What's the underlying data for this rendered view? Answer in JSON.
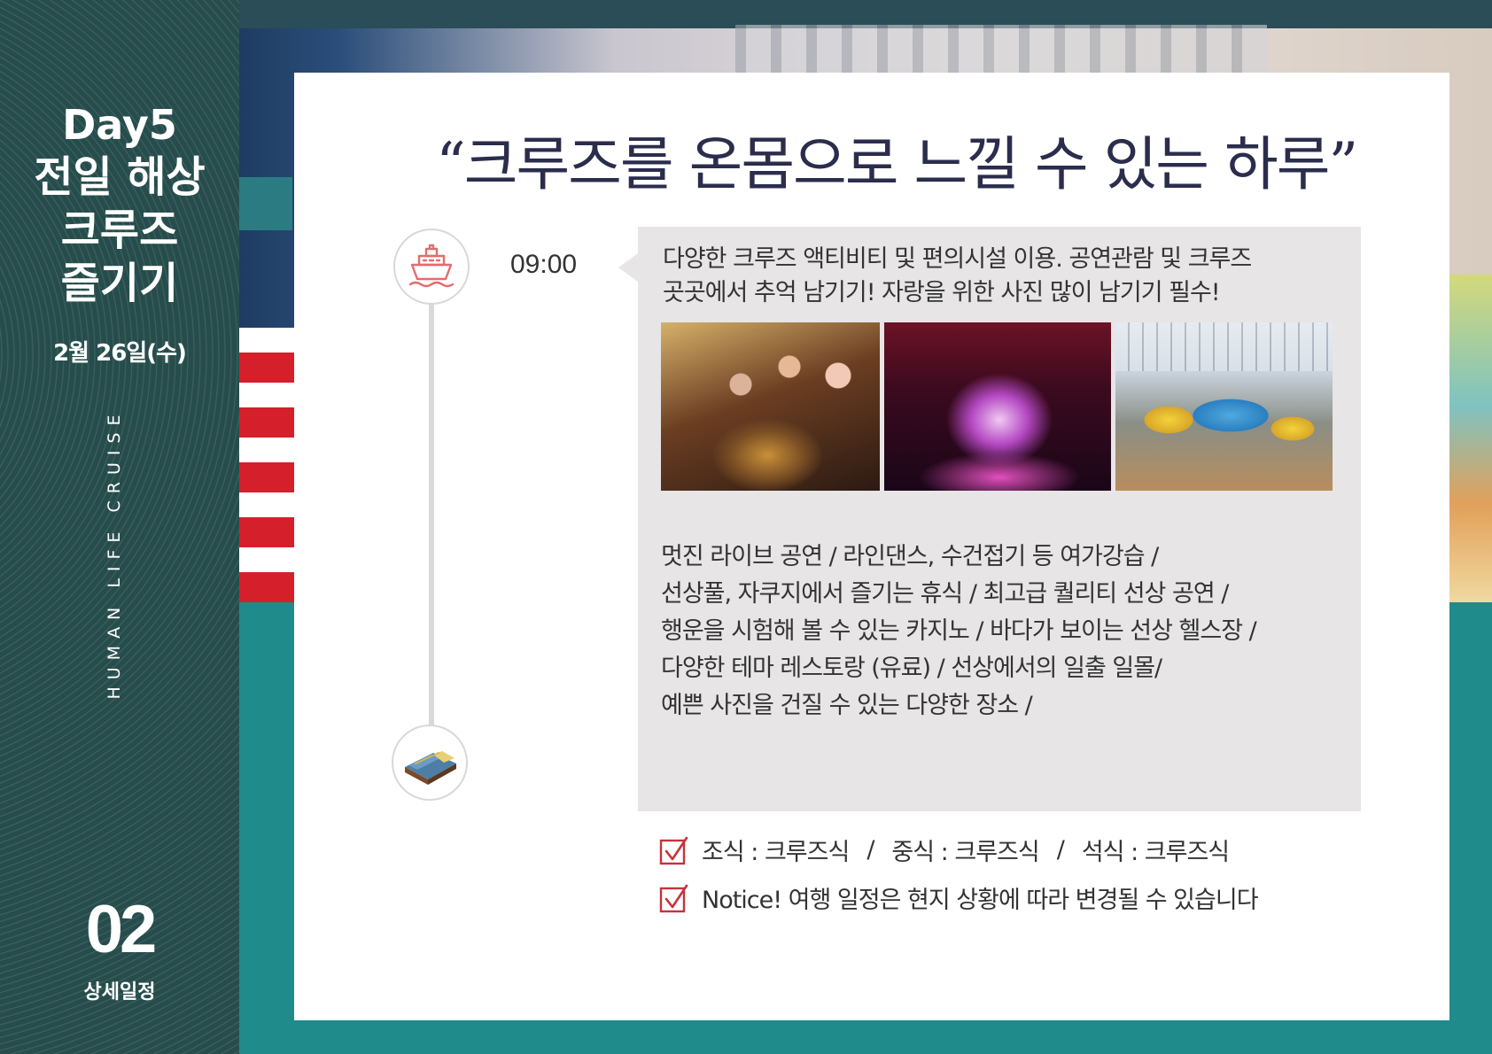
{
  "sidebar": {
    "day": "Day5",
    "title": "전일 해상\n크루즈\n즐기기",
    "date": "2월 26일(수)",
    "vertical_text": "HUMAN LIFE CRUISE",
    "page_number": "02",
    "page_label": "상세일정"
  },
  "headline": "“크루즈를 온몸으로 느낄 수 있는 하루”",
  "timeline": {
    "time": "09:00",
    "start_icon": "cruise-ship-icon",
    "end_icon": "bed-icon"
  },
  "content": {
    "intro": [
      "다양한 크루즈 액티비티 및 편의시설 이용. 공연관람 및 크루즈",
      "곳곳에서 추억 남기기! 자랑을 위한 사진 많이 남기기 필수!"
    ],
    "activities": [
      "멋진 라이브 공연 / 라인댄스, 수건접기 등 여가강습 /",
      "선상풀, 자쿠지에서 즐기는 휴식 / 최고급 퀄리티 선상 공연 /",
      "행운을 시험해 볼 수 있는 카지노 / 바다가 보이는 선상 헬스장 /",
      "다양한 테마 레스토랑 (유료) / 선상에서의 일출 일몰/",
      "예쁜 사진을 건질 수 있는 다양한 장소 /"
    ]
  },
  "meals": {
    "breakfast": "조식 : 크루즈식",
    "lunch": "중식 : 크루즈식",
    "dinner": "석식 : 크루즈식",
    "separator": "/"
  },
  "notice": "Notice!  여행 일정은 현지 상황에 따라 변경될 수 있습니다",
  "colors": {
    "sidebar_bg": "#264d4c",
    "teal_bg": "#1f8b8a",
    "headline": "#2b2d4d",
    "accent_red": "#c6333a",
    "content_box": "#e7e5e6"
  }
}
